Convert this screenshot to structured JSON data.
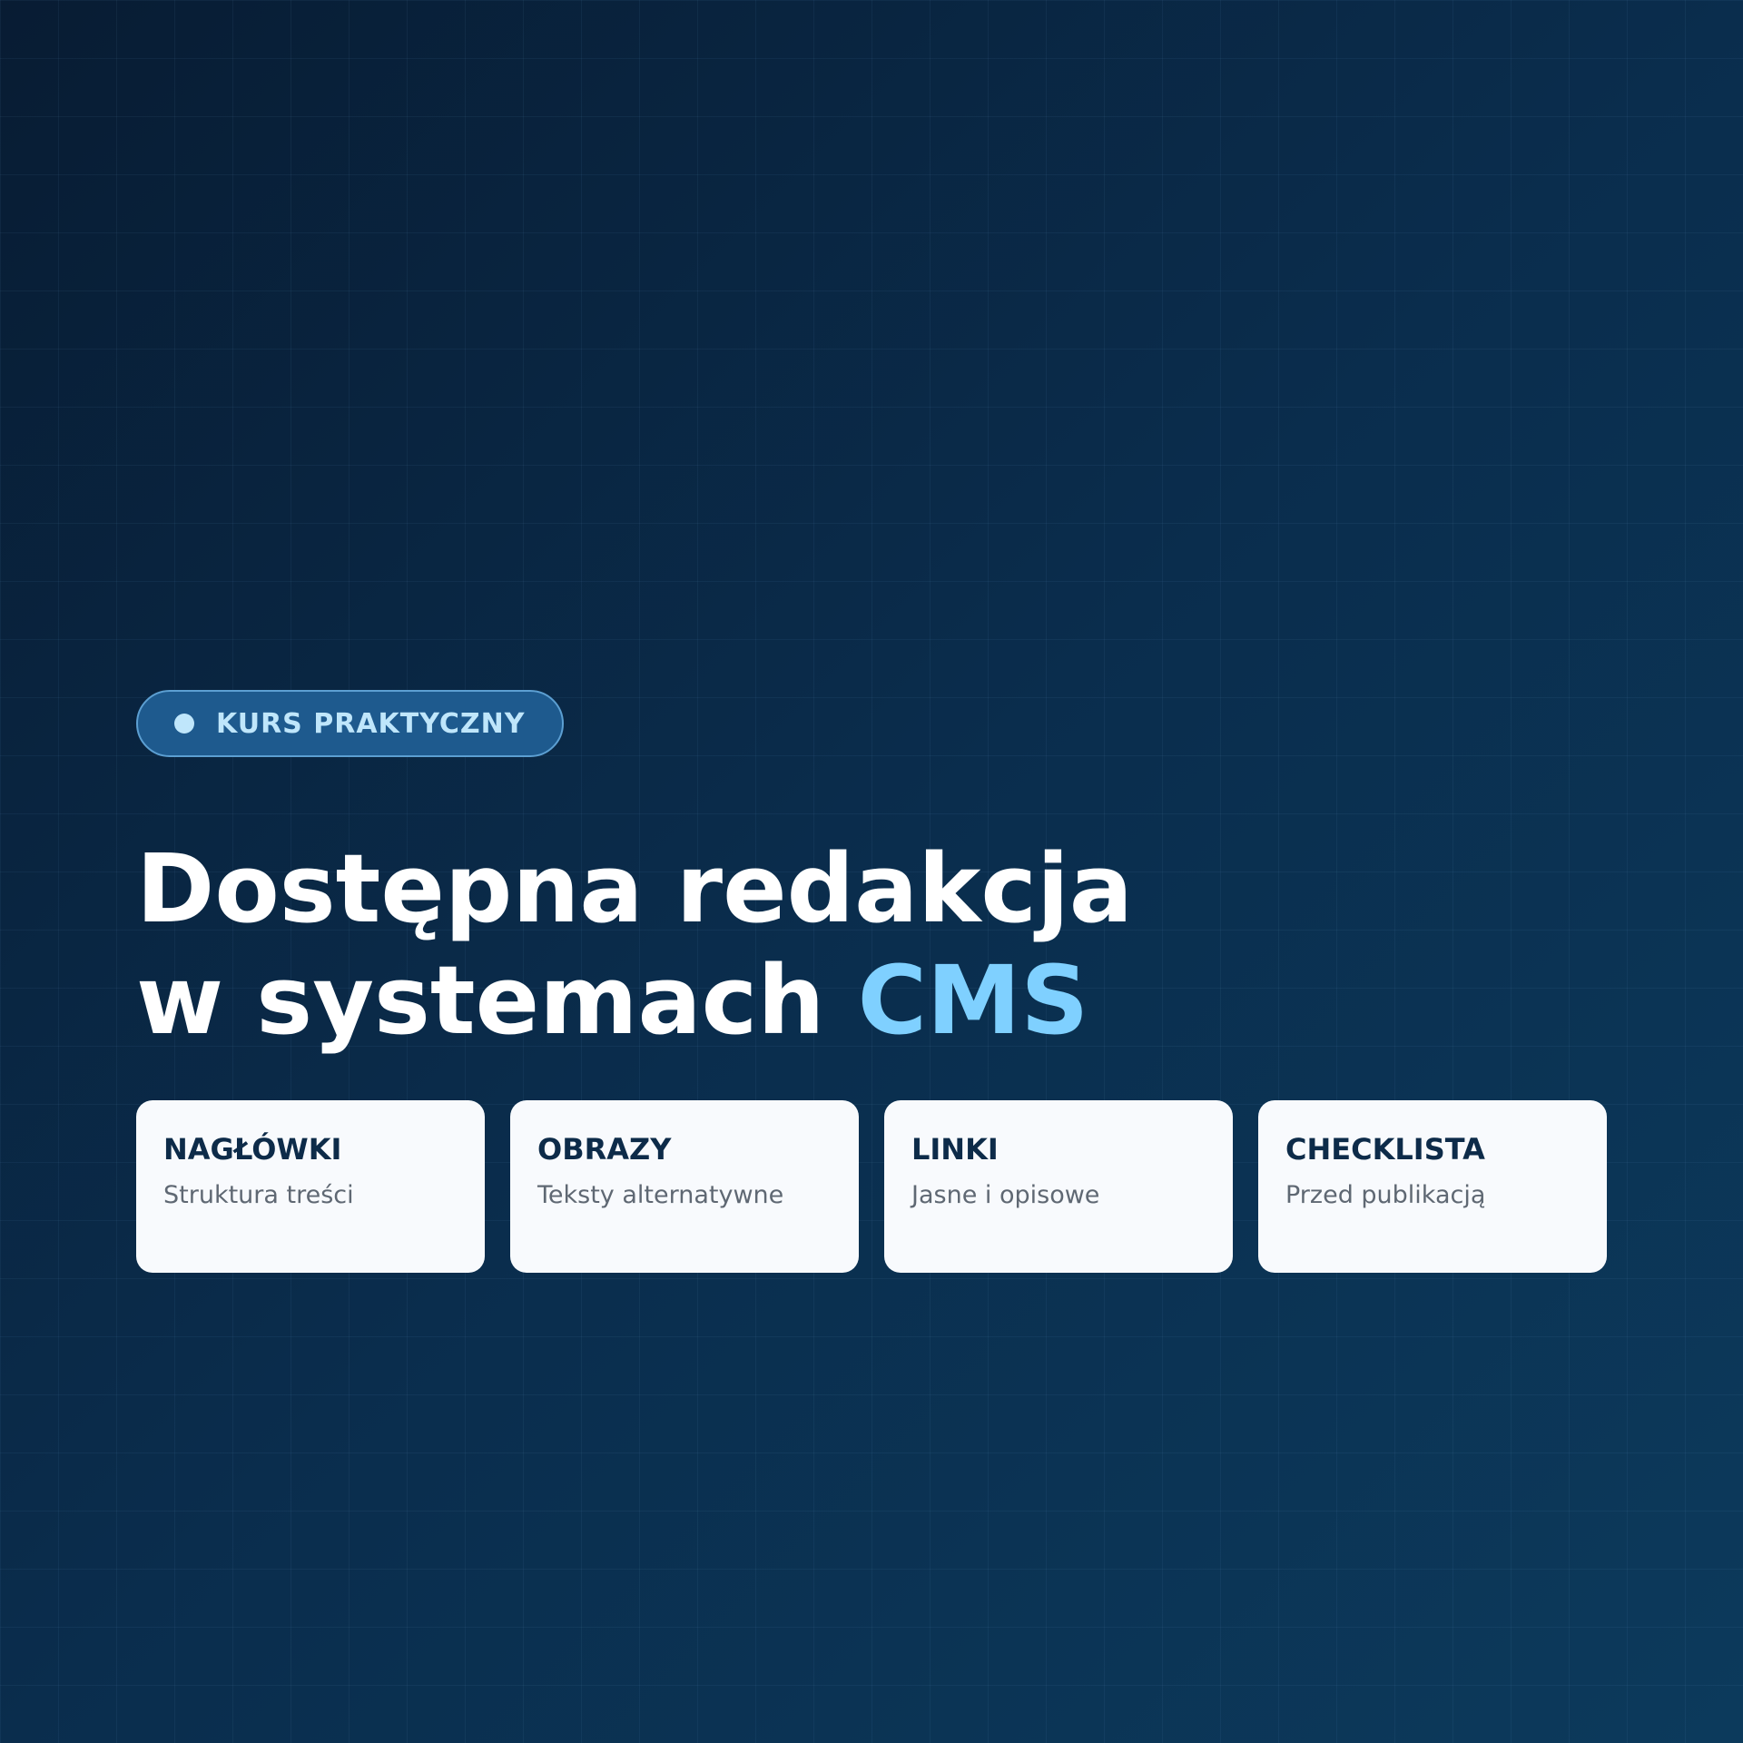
{
  "badge": {
    "label": "KURS PRAKTYCZNY"
  },
  "headline": {
    "line1": "Dostępna redakcja",
    "line2_prefix": "w systemach ",
    "line2_accent": "CMS"
  },
  "cards": [
    {
      "title": "NAGŁÓWKI",
      "description": "Struktura treści"
    },
    {
      "title": "OBRAZY",
      "description": "Teksty alternatywne"
    },
    {
      "title": "LINKI",
      "description": "Jasne i opisowe"
    },
    {
      "title": "CHECKLISTA",
      "description": "Przed publikacją"
    }
  ],
  "colors": {
    "background": "#0a2d4d",
    "accent": "#7fd0ff",
    "badge_fill": "#1e5a8e",
    "card_bg": "#f8fafd",
    "card_title": "#0d2b49"
  }
}
